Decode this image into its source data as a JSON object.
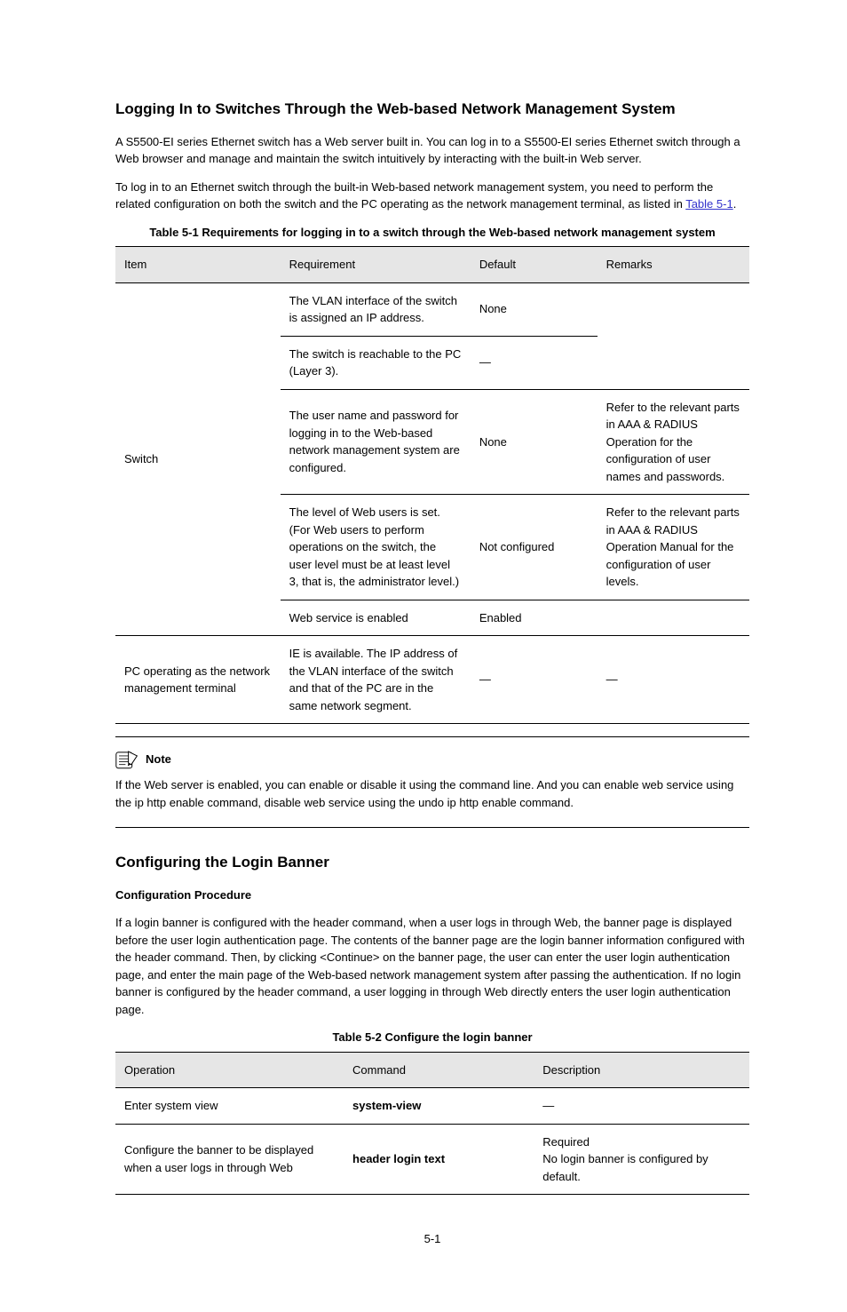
{
  "section": {
    "heading": "Logging In to Switches Through the Web-based Network Management System",
    "para1_prefix": "A S5500-EI series Ethernet switch has a Web server built in. You can log in to a S5500-EI series Ethernet switch through a Web browser and manage and maintain the switch intuitively by interacting with the built-in Web server.",
    "para2_before_link": "To log in to an Ethernet switch through the built-in Web-based network management system, you need to perform the related configuration on both the switch and the PC operating as the network management terminal, as listed in ",
    "link_text": "Table 5-1",
    "para2_after_link": "."
  },
  "table1": {
    "caption": "Table 5-1 Requirements for logging in to a switch through the Web-based network management system",
    "headers": [
      "Item",
      "Requirement",
      "Default",
      "Remarks"
    ],
    "rows": [
      {
        "item": "",
        "req": "The VLAN interface of the switch is assigned an IP address.",
        "def": "None",
        "rem": ""
      },
      {
        "item": "",
        "req": "The switch is reachable to the PC (Layer 3).",
        "def": "—",
        "rem": ""
      },
      {
        "item": "Switch",
        "req": "The user name and password for logging in to the Web-based network management system are configured.",
        "def": "None",
        "rem": "Refer to the relevant parts in AAA & RADIUS Operation for the configuration of user names and passwords."
      },
      {
        "item": "",
        "req": "The level of Web users is set. (For Web users to perform operations on the switch, the user level must be at least level 3, that is, the administrator level.)",
        "def": "Not configured",
        "rem": "Refer to the relevant parts in AAA & RADIUS Operation Manual for the configuration of user levels."
      },
      {
        "item": "",
        "req": "Web service is enabled",
        "def": "Enabled",
        "rem": ""
      },
      {
        "item": "PC operating as the network management terminal",
        "req": "IE is available. The IP address of the VLAN interface of the switch and that of the PC are in the same network segment.",
        "def": "—",
        "rem": "—"
      }
    ]
  },
  "note": {
    "label": "Note",
    "text": "If the Web server is enabled, you can enable or disable it using the command line. And you can enable web service using the ip http enable command, disable web service using the undo ip http enable command."
  },
  "section2": {
    "heading": "Configuring the Login Banner",
    "sub": "Configuration Procedure",
    "para": "If a login banner is configured with the header command, when a user logs in through Web, the banner page is displayed before the user login authentication page. The contents of the banner page are the login banner information configured with the header command. Then, by clicking <Continue> on the banner page, the user can enter the user login authentication page, and enter the main page of the Web-based network management system after passing the authentication. If no login banner is configured by the header command, a user logging in through Web directly enters the user login authentication page."
  },
  "table2": {
    "caption": "Table 5-2 Configure the login banner",
    "headers": [
      "Operation",
      "Command",
      "Description"
    ],
    "rows": [
      {
        "op": "Enter system view",
        "cmd": "system-view",
        "desc": "—"
      },
      {
        "op": "Configure the banner to be displayed when a user logs in through Web",
        "cmd": "header login text",
        "desc": "Required\nNo login banner is configured by default."
      }
    ]
  },
  "footer": {
    "page": "5-1"
  }
}
